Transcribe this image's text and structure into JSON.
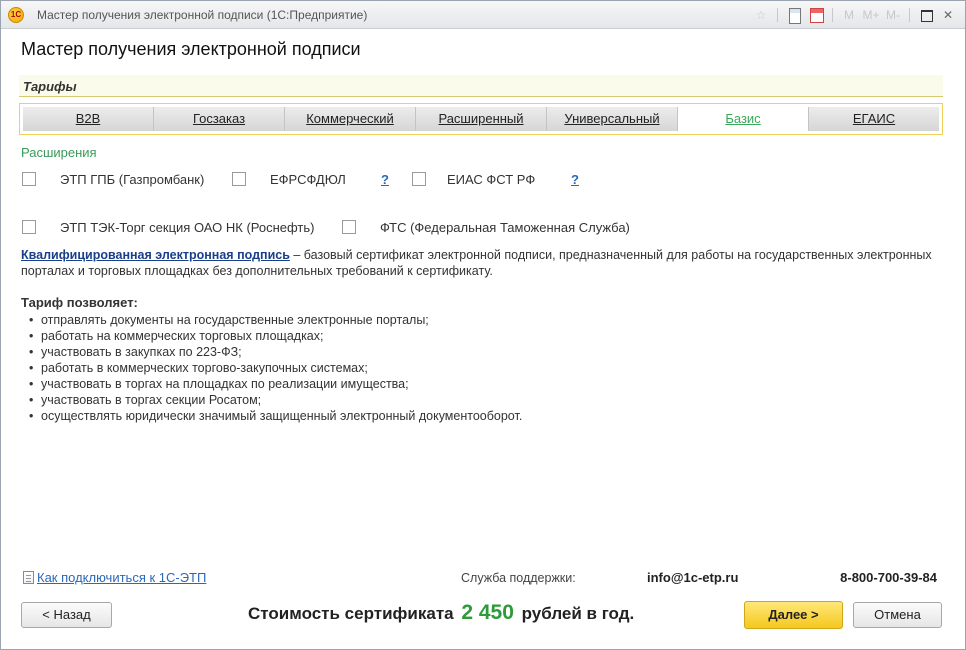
{
  "window": {
    "title": "Мастер получения электронной подписи  (1С:Предприятие)",
    "app_icon": "1С",
    "toolbar_icons": [
      "star-icon",
      "calculator-icon",
      "calendar-icon",
      "memory-icon",
      "maximize-icon",
      "close-icon"
    ],
    "toolbar_labels": {
      "m": "M",
      "mplus": "M+",
      "mminus": "M-",
      "close": "✕"
    }
  },
  "page": {
    "title": "Мастер получения электронной подписи"
  },
  "tariffs": {
    "group_title": "Тарифы",
    "active": "Базис",
    "tabs": [
      {
        "label": "B2B"
      },
      {
        "label": "Госзаказ"
      },
      {
        "label": "Коммерческий"
      },
      {
        "label": "Расширенный"
      },
      {
        "label": "Универсальный"
      },
      {
        "label": "Базис"
      },
      {
        "label": "ЕГАИС"
      }
    ]
  },
  "extensions": {
    "title": "Расширения",
    "items": [
      {
        "label": "ЭТП ГПБ (Газпромбанк)",
        "checked": false
      },
      {
        "label": "ЕФРСФДЮЛ",
        "checked": false,
        "help": "?"
      },
      {
        "label": "ЕИАС ФСТ РФ",
        "checked": false,
        "help": "?"
      },
      {
        "label": "ЭТП ТЭК-Торг секция ОАО НК (Роснефть)",
        "checked": false
      },
      {
        "label": "ФТС (Федеральная Таможенная Служба)",
        "checked": false
      }
    ]
  },
  "description": {
    "link": "Квалифицированная электронная подпись",
    "text": " – базовый сертификат электронной подписи, предназначенный для работы на государственных электронных порталах и торговых площадках без дополнительных требований к сертификату."
  },
  "features": {
    "title": "Тариф позволяет:",
    "items": [
      "отправлять документы на государственные электронные порталы;",
      "работать на коммерческих торговых площадках;",
      "участвовать в закупках по 223-ФЗ;",
      "работать в коммерческих торгово-закупочных системах;",
      "участвовать в торгах на площадках по реализации имущества;",
      "участвовать в торгах секции Росатом;",
      "осуществлять юридически значимый защищенный электронный документооборот."
    ]
  },
  "footer": {
    "connect_link": "Как подключиться к 1С-ЭТП",
    "support_label": "Служба поддержки:",
    "support_email": "info@1c-etp.ru",
    "support_phone": "8-800-700-39-84",
    "price_prefix": "Стоимость сертификата",
    "price_value": "2 450",
    "price_suffix": "рублей в год.",
    "back_label": "< Назад",
    "next_label": "Далее >",
    "cancel_label": "Отмена"
  }
}
